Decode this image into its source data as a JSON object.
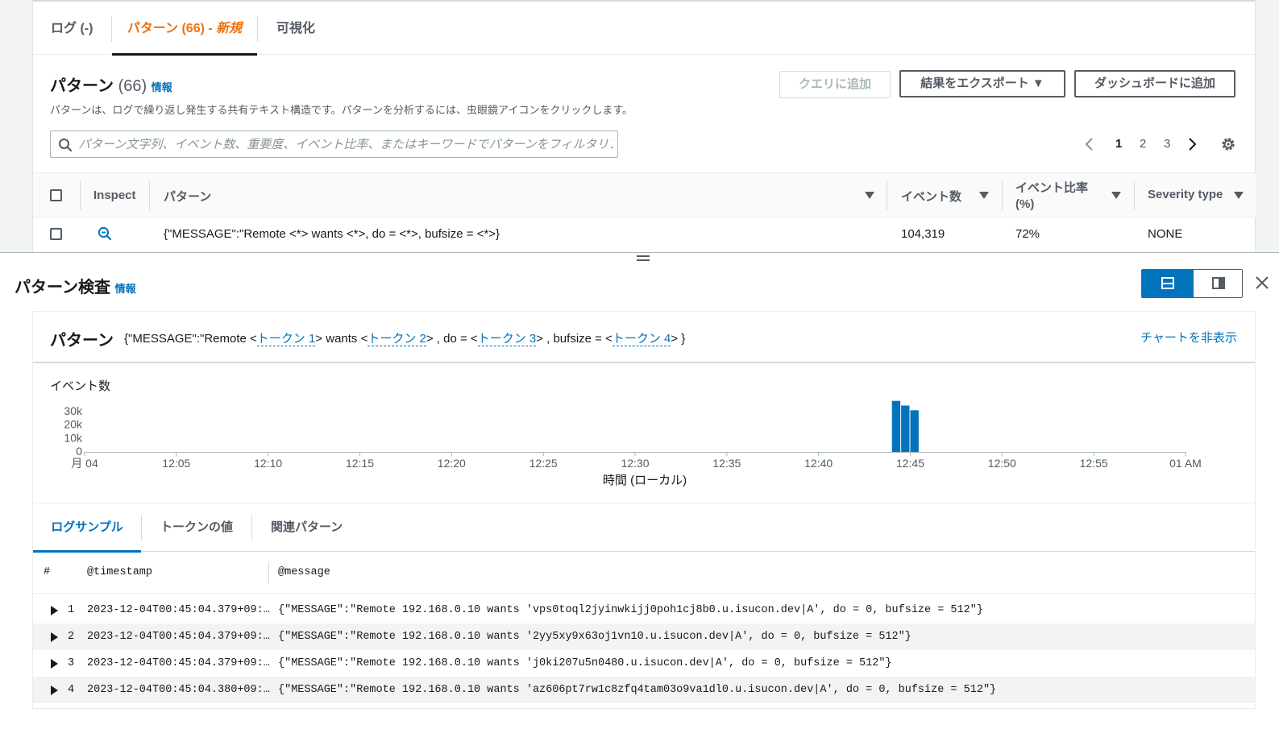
{
  "tabs": [
    {
      "label": "ログ (-)"
    },
    {
      "label": "パターン (66) - ",
      "suffix": "新規"
    },
    {
      "label": "可視化"
    }
  ],
  "patterns_panel": {
    "title": "パターン",
    "count": "(66)",
    "info": "情報",
    "description": "パターンは、ログで繰り返し発生する共有テキスト構造です。パターンを分析するには、虫眼鏡アイコンをクリックします。",
    "buttons": {
      "add_to_query": "クエリに追加",
      "export_results": "結果をエクスポート ▼",
      "add_to_dashboard": "ダッシュボードに追加"
    },
    "search": {
      "value": "",
      "placeholder": "パターン文字列、イベント数、重要度、イベント比率、またはキーワードでパターンをフィルタリング"
    },
    "pagination": {
      "pages": [
        "1",
        "2",
        "3"
      ],
      "current": "1"
    },
    "table": {
      "headers": {
        "inspect": "Inspect",
        "pattern": "パターン",
        "event_count": "イベント数",
        "event_ratio_line1": "イベント比率",
        "event_ratio_line2": "(%)",
        "severity": "Severity type"
      },
      "rows": [
        {
          "pattern": "{\"MESSAGE\":\"Remote <*> wants <*>, do = <*>, bufsize = <*>}",
          "event_count": "104,319",
          "event_ratio": "72%",
          "severity": "NONE"
        }
      ]
    }
  },
  "inspect_panel": {
    "title": "パターン検査",
    "info": "情報",
    "pattern_label": "パターン",
    "pattern_parts": {
      "p1": "{\"MESSAGE\":\"Remote <",
      "t1": "トークン 1",
      "p2": "> wants <",
      "t2": "トークン 2",
      "p3": "> , do = <",
      "t3": "トークン 3",
      "p4": "> , bufsize = <",
      "t4": "トークン 4",
      "p5": "> }"
    },
    "hide_chart": "チャートを非表示",
    "subtabs": [
      "ログサンプル",
      "トークンの値",
      "関連パターン"
    ],
    "log_table": {
      "headers": {
        "num": "#",
        "timestamp": "@timestamp",
        "message": "@message"
      },
      "rows": [
        {
          "num": "1",
          "timestamp": "2023-12-04T00:45:04.379+09:…",
          "message": "{\"MESSAGE\":\"Remote 192.168.0.10 wants 'vps0toql2jyinwkijj0poh1cj8b0.u.isucon.dev|A', do = 0, bufsize = 512\"}"
        },
        {
          "num": "2",
          "timestamp": "2023-12-04T00:45:04.379+09:…",
          "message": "{\"MESSAGE\":\"Remote 192.168.0.10 wants '2yy5xy9x63oj1vn10.u.isucon.dev|A', do = 0, bufsize = 512\"}"
        },
        {
          "num": "3",
          "timestamp": "2023-12-04T00:45:04.379+09:…",
          "message": "{\"MESSAGE\":\"Remote 192.168.0.10 wants 'j0ki207u5n0480.u.isucon.dev|A', do = 0, bufsize = 512\"}"
        },
        {
          "num": "4",
          "timestamp": "2023-12-04T00:45:04.380+09:…",
          "message": "{\"MESSAGE\":\"Remote 192.168.0.10 wants 'az606pt7rw1c8zfq4tam03o9va1dl0.u.isucon.dev|A', do = 0, bufsize = 512\"}"
        }
      ]
    }
  },
  "chart_data": {
    "type": "bar",
    "title": "",
    "ylabel": "イベント数",
    "xlabel": "時間 (ローカル)",
    "x_ticks": [
      "月 04",
      "12:05",
      "12:10",
      "12:15",
      "12:20",
      "12:25",
      "12:30",
      "12:35",
      "12:40",
      "12:45",
      "12:50",
      "12:55",
      "01 AM"
    ],
    "y_ticks": [
      "0",
      "10k",
      "20k",
      "30k"
    ],
    "ylim": [
      0,
      30000
    ],
    "xlim_minutes": [
      0,
      60
    ],
    "bars": [
      {
        "minute": 44.0,
        "value": 38000
      },
      {
        "minute": 44.5,
        "value": 34500
      },
      {
        "minute": 45.0,
        "value": 31000
      }
    ],
    "grid": false,
    "bar_color": "#0073bb"
  }
}
